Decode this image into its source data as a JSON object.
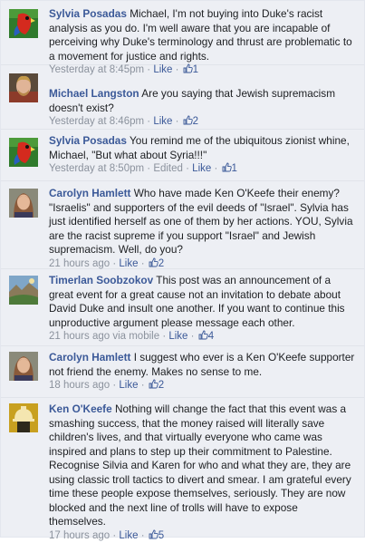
{
  "labels": {
    "like": "Like",
    "sep": "·",
    "edited": "Edited"
  },
  "comments": [
    {
      "author": "Sylvia Posadas",
      "text": "Michael, I'm not buying into Duke's racist analysis as you do. I'm well aware that you are incapable of perceiving why Duke's terminology and thrust are problematic to a movement for justice and rights.",
      "time": "Yesterday at 8:45pm",
      "likes": "1",
      "avatar": "parrot-icon"
    },
    {
      "author": "Michael Langston",
      "text": "Are you saying that Jewish supremacism doesn't exist?",
      "time": "Yesterday at 8:46pm",
      "likes": "2",
      "avatar": "man-portrait-icon"
    },
    {
      "author": "Sylvia Posadas",
      "text": "You remind me of the ubiquitous zionist whine, Michael, \"But what about Syria!!!\"",
      "time": "Yesterday at 8:50pm",
      "likes": "1",
      "avatar": "parrot-icon"
    },
    {
      "author": "Carolyn Hamlett",
      "text": "Who have made Ken O'Keefe their enemy? \"Israelis\" and supporters of the evil deeds of \"Israel\". Sylvia has just identified herself as one of them by her actions. YOU, Sylvia are the racist supreme if you support \"Israel\" and Jewish supremacism. Well, do you?",
      "time": "21 hours ago",
      "likes": "2",
      "avatar": "woman-portrait-icon"
    },
    {
      "author": "Timerlan Soobzokov",
      "text": "This post was an announcement of a great event for a great cause not an invitation to debate about David Duke and insult one another. If you want to continue this unproductive argument please message each other.",
      "time": "21 hours ago via mobile",
      "likes": "4",
      "avatar": "landscape-icon"
    },
    {
      "author": "Carolyn Hamlett",
      "text": "I suggest who ever is a Ken O'Keefe supporter not friend the enemy. Makes no sense to me.",
      "time": "18 hours ago",
      "likes": "2",
      "avatar": "woman-portrait-icon"
    },
    {
      "author": "Ken O'Keefe",
      "text": "Nothing will change the fact that this event was a smashing success, that the money raised will literally save children's lives, and that virtually everyone who came was inspired and plans to step up their commitment to Palestine. Recognise Silvia and Karen for who and what they are, they are using classic troll tactics to divert and smear. I am grateful every time these people expose themselves, seriously. They are now blocked and the next line of trolls will have to expose themselves.",
      "time": "17 hours ago",
      "likes": "5",
      "avatar": "helmet-avatar-icon"
    }
  ]
}
